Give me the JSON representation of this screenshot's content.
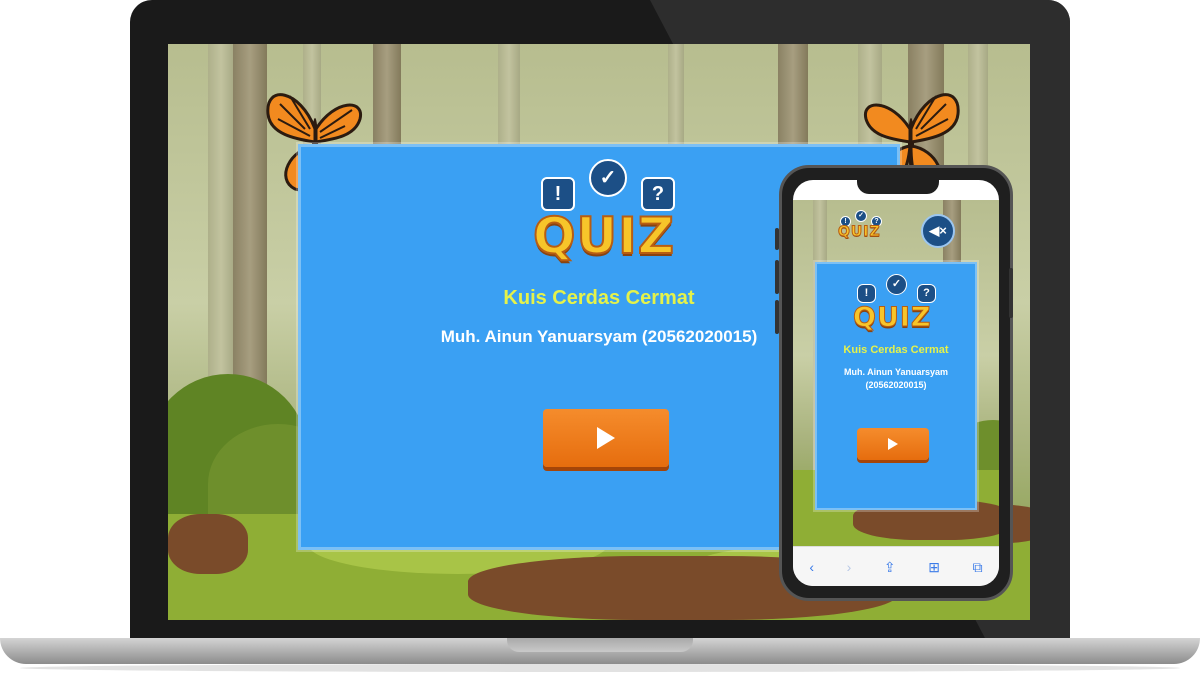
{
  "quiz": {
    "logo_text": "QUIZ",
    "bubble_left": "!",
    "bubble_mid": "✓",
    "bubble_right": "?",
    "title": "Kuis Cerdas Cermat",
    "author": "Muh. Ainun Yanuarsyam (20562020015)",
    "author_line1": "Muh. Ainun Yanuarsyam",
    "author_line2": "(20562020015)",
    "play_icon": "play-icon"
  },
  "phone": {
    "mute_icon": "speaker-muted-icon",
    "mute_glyph": "🔇",
    "toolbar": [
      {
        "name": "back-icon",
        "glyph": "‹",
        "dim": false
      },
      {
        "name": "forward-icon",
        "glyph": "›",
        "dim": true
      },
      {
        "name": "share-icon",
        "glyph": "⇪",
        "dim": false
      },
      {
        "name": "bookmarks-icon",
        "glyph": "⊞",
        "dim": false
      },
      {
        "name": "tabs-icon",
        "glyph": "⧉",
        "dim": false
      }
    ]
  },
  "colors": {
    "card": "#3aa0f3",
    "title": "#e5f24a",
    "play_button": "#f58c2c",
    "bubble": "#1c4f86"
  }
}
